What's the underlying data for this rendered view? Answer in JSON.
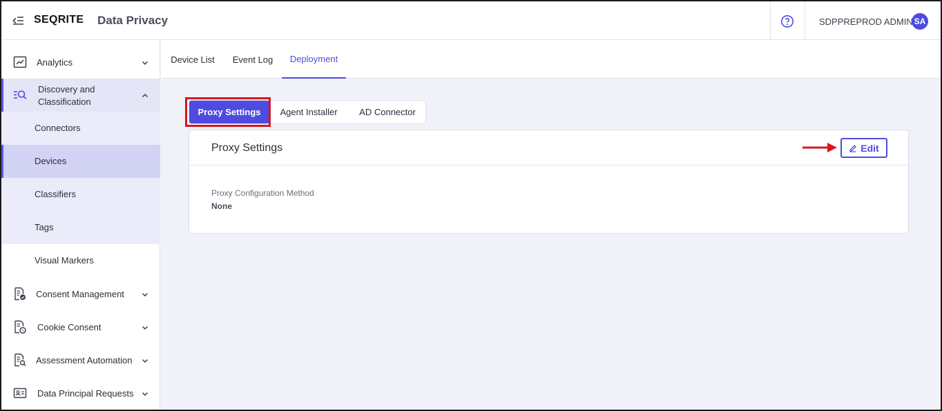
{
  "header": {
    "logo_prefix": "SEQ",
    "logo_suffix": "RITE",
    "app_title": "Data Privacy",
    "user_name": "SDPPREPROD ADMIN",
    "avatar_initials": "SA"
  },
  "sidebar": {
    "items": [
      {
        "label": "Analytics",
        "icon": "trend-chart-icon"
      },
      {
        "label": "Discovery and Classification",
        "label_line1": "Discovery and",
        "label_line2": "Classification",
        "icon": "search-list-icon"
      },
      {
        "label": "Consent Management",
        "icon": "document-check-icon"
      },
      {
        "label": "Cookie Consent",
        "icon": "cookie-doc-icon"
      },
      {
        "label": "Assessment Automation",
        "icon": "document-search-icon"
      },
      {
        "label": "Data Principal Requests",
        "icon": "id-card-icon"
      }
    ],
    "sub_items": [
      {
        "label": "Connectors"
      },
      {
        "label": "Devices"
      },
      {
        "label": "Classifiers"
      },
      {
        "label": "Tags"
      },
      {
        "label": "Visual Markers"
      }
    ]
  },
  "tabs": [
    {
      "label": "Device List"
    },
    {
      "label": "Event Log"
    },
    {
      "label": "Deployment"
    }
  ],
  "subtabs": [
    {
      "label": "Proxy Settings"
    },
    {
      "label": "Agent Installer"
    },
    {
      "label": "AD Connector"
    }
  ],
  "card": {
    "title": "Proxy Settings",
    "edit_label": "Edit",
    "field_label": "Proxy Configuration Method",
    "field_value": "None"
  },
  "colors": {
    "accent": "#4e4be0",
    "highlight": "#d8161d",
    "background": "#f0f1f9"
  }
}
